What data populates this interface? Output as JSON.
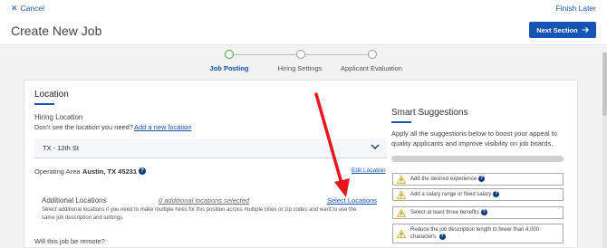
{
  "topbar": {
    "cancel_label": "Cancel",
    "finish_label": "Finish Later"
  },
  "header": {
    "title": "Create New Job",
    "next_label": "Next Section"
  },
  "stepper": {
    "steps": [
      {
        "label": "Job Posting",
        "active": true
      },
      {
        "label": "Hiring Settings",
        "active": false
      },
      {
        "label": "Applicant Evaluation",
        "active": false
      }
    ]
  },
  "location": {
    "section_title": "Location",
    "hiring_location_label": "Hiring Location",
    "not_see_text": "Don't see the location you need?",
    "add_location_link": "Add a new location",
    "selected_location": "TX - 12th St",
    "operating_area_label": "Operating Area",
    "operating_area_value": "Austin, TX 45231",
    "edit_location_link": "Edit Location",
    "additional_title": "Additional Locations",
    "additional_count": "0 additional locations selected",
    "select_locations_link": "Select Locations",
    "additional_desc_1": "Select additional locations if you need to make multiple hires for this position across multiple cities or zip codes and want to use the",
    "additional_desc_2": "same job description and settings.",
    "remote_question": "Will this job be remote?"
  },
  "smart": {
    "title": "Smart Suggestions",
    "desc": "Apply all the suggestions below to boost your appeal to quality applicants and improve visibility on job boards.",
    "progress": 0,
    "items": [
      "Add the desired experience",
      "Add a salary range or fixed salary",
      "Select at least three benefits",
      "Reduce the job description length to fewer than 4,000 characters."
    ]
  },
  "colors": {
    "accent": "#1553b5",
    "active_step": "#3ca33c",
    "annotation_arrow": "#e8141e",
    "warning": "#e8b800"
  },
  "icons": [
    "close-icon",
    "arrow-right-icon",
    "chevron-down-icon",
    "help-icon",
    "warning-icon"
  ]
}
